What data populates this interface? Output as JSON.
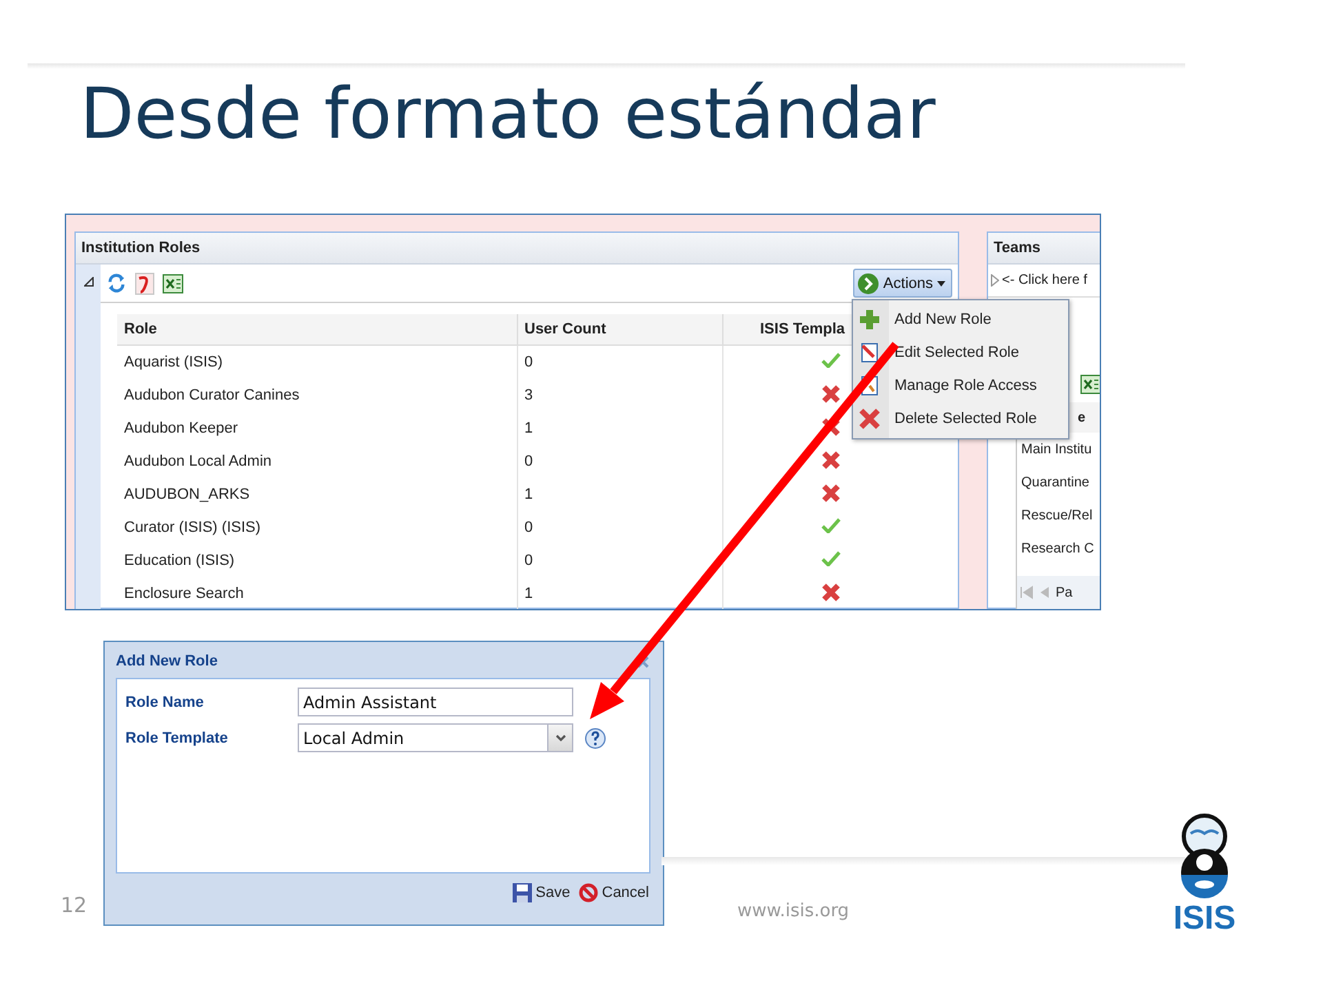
{
  "slide": {
    "title": "Desde formato estándar",
    "page_number": "12",
    "url": "www.isis.org",
    "logo_text": "ISIS"
  },
  "roles_panel": {
    "title": "Institution Roles",
    "actions_button": "Actions",
    "columns": [
      "Role",
      "User Count",
      "ISIS Templa"
    ],
    "rows": [
      {
        "role": "Aquarist (ISIS)",
        "user_count": "0",
        "isis_template": true
      },
      {
        "role": "Audubon Curator Canines",
        "user_count": "3",
        "isis_template": false
      },
      {
        "role": "Audubon Keeper",
        "user_count": "1",
        "isis_template": false
      },
      {
        "role": "Audubon Local Admin",
        "user_count": "0",
        "isis_template": false
      },
      {
        "role": "AUDUBON_ARKS",
        "user_count": "1",
        "isis_template": false
      },
      {
        "role": "Curator (ISIS) (ISIS)",
        "user_count": "0",
        "isis_template": true
      },
      {
        "role": "Education (ISIS)",
        "user_count": "0",
        "isis_template": true
      },
      {
        "role": "Enclosure Search",
        "user_count": "1",
        "isis_template": false
      }
    ]
  },
  "actions_menu": {
    "items": [
      {
        "label": "Add New Role",
        "kind": "add"
      },
      {
        "label": "Edit Selected Role",
        "kind": "edit"
      },
      {
        "label": "Manage Role Access",
        "kind": "access"
      },
      {
        "label": "Delete Selected Role",
        "kind": "delete"
      }
    ]
  },
  "teams_panel": {
    "title": "Teams",
    "hint": "<- Click here f",
    "column_1": "e",
    "rows": [
      "Main Institu",
      "Quarantine",
      "Rescue/Rel",
      "Research C"
    ],
    "pager_text": "Pa"
  },
  "dialog": {
    "title": "Add New Role",
    "fields": [
      {
        "label": "Role Name",
        "kind": "text",
        "value": "Admin Assistant"
      },
      {
        "label": "Role Template",
        "kind": "combo",
        "value": "Local Admin"
      }
    ],
    "buttons": [
      {
        "label": "Save",
        "kind": "save"
      },
      {
        "label": "Cancel",
        "kind": "cancel"
      }
    ]
  }
}
